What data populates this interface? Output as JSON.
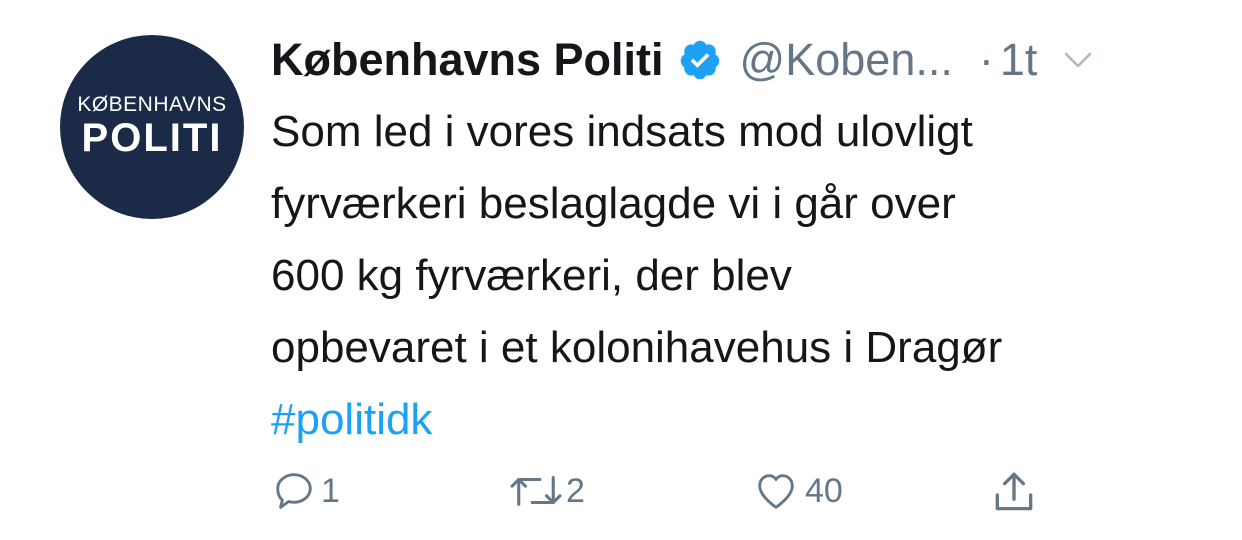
{
  "tweet": {
    "avatar": {
      "line1": "KØBENHAVNS",
      "line2": "POLITI",
      "bg_color": "#1b2a47"
    },
    "display_name": "Københavns Politi",
    "verified_icon": "verified-badge-icon",
    "handle": "@Koben...",
    "separator": "·",
    "time": "1t",
    "text_lines": [
      "Som led i vores indsats mod ulovligt",
      "fyrværkeri beslaglagde vi i går over",
      "600 kg fyrværkeri, der blev",
      "opbevaret i et kolonihavehus i Dragør"
    ],
    "hashtag": "#politidk",
    "actions": {
      "reply": {
        "icon": "reply-bubble-icon",
        "count": "1"
      },
      "retweet": {
        "icon": "retweet-icon",
        "count": "2"
      },
      "like": {
        "icon": "heart-icon",
        "count": "40"
      },
      "share": {
        "icon": "share-icon"
      }
    }
  },
  "colors": {
    "accent": "#1da1f2",
    "text": "#14171a",
    "muted": "#657786",
    "avatar_bg": "#1b2a47"
  }
}
